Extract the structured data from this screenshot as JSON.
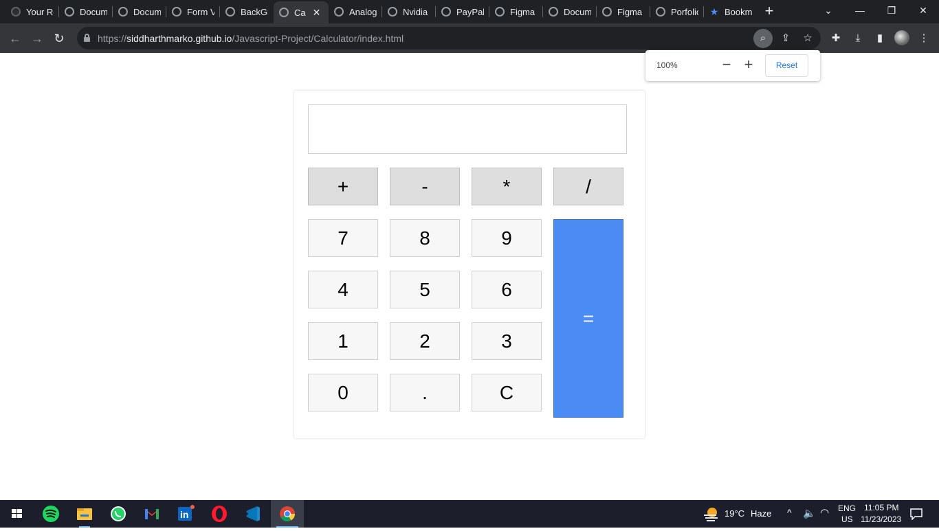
{
  "tabs": [
    {
      "title": "Your Re",
      "active": false
    },
    {
      "title": "Docum",
      "active": false
    },
    {
      "title": "Docum",
      "active": false
    },
    {
      "title": "Form V",
      "active": false
    },
    {
      "title": "BackGr",
      "active": false
    },
    {
      "title": "Ca",
      "active": true
    },
    {
      "title": "Analog",
      "active": false
    },
    {
      "title": "Nvidia",
      "active": false
    },
    {
      "title": "PayPal",
      "active": false
    },
    {
      "title": "Figma",
      "active": false
    },
    {
      "title": "Docum",
      "active": false
    },
    {
      "title": "Figma",
      "active": false
    },
    {
      "title": "Porfolio",
      "active": false
    },
    {
      "title": "Bookm",
      "active": false
    }
  ],
  "address": {
    "scheme": "https://",
    "host": "siddharthmarko.github.io",
    "path": "/Javascript-Project/Calculator/index.html"
  },
  "zoom_popup": {
    "level": "100%",
    "reset_label": "Reset"
  },
  "calculator": {
    "display_value": "",
    "operators": [
      "+",
      "-",
      "*",
      "/"
    ],
    "digits": [
      "7",
      "8",
      "9",
      "4",
      "5",
      "6",
      "1",
      "2",
      "3",
      "0",
      ".",
      "C"
    ],
    "equals": "=",
    "accent_color": "#4b8bf4"
  },
  "taskbar": {
    "weather_temp": "19°C",
    "weather_desc": "Haze",
    "lang": "ENG",
    "region": "US",
    "time": "11:05 PM",
    "date": "11/23/2023"
  }
}
